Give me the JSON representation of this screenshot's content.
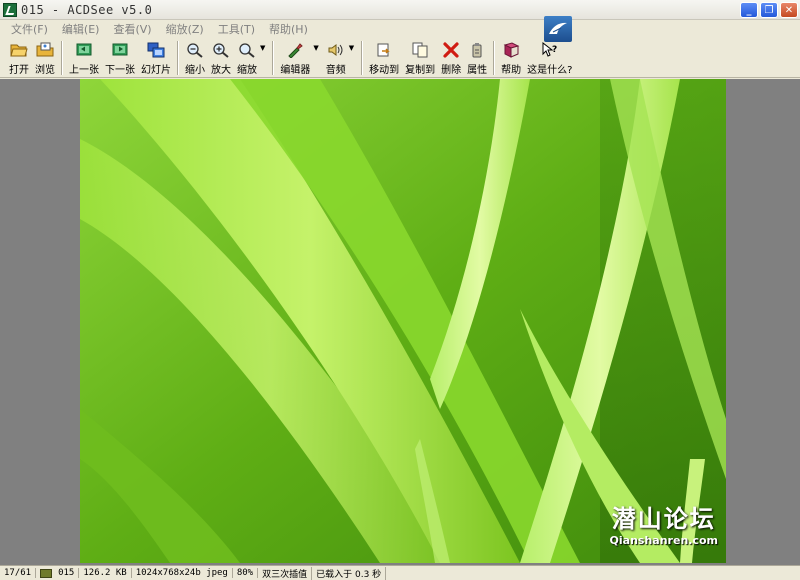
{
  "window": {
    "title": "015 - ACDSee v5.0",
    "controls": [
      "_",
      "❐",
      "✕"
    ]
  },
  "menu": {
    "items": [
      "文件(F)",
      "编辑(E)",
      "查看(V)",
      "缩放(Z)",
      "工具(T)",
      "帮助(H)"
    ]
  },
  "toolbar": {
    "open": "打开",
    "browse": "浏览",
    "prev": "上一张",
    "next": "下一张",
    "slideshow": "幻灯片",
    "zoom_out": "缩小",
    "zoom_in": "放大",
    "zoom": "缩放",
    "editor": "编辑器",
    "audio": "音频",
    "move_to": "移动到",
    "copy_to": "复制到",
    "delete": "删除",
    "properties": "属性",
    "help": "帮助",
    "whats_this": "这是什么?"
  },
  "status": {
    "index": "17/61",
    "name": "015",
    "size": "126.2 KB",
    "dims": "1024x768x24b jpeg",
    "zoom": "80%",
    "interp": "双三次插值",
    "load": "已载入于 0.3 秒"
  },
  "watermark": {
    "big": "潜山论坛",
    "small": "Qianshanren.com"
  },
  "colors": {
    "titlebar": "#eeede6",
    "chrome": "#ece9d8",
    "viewer_bg": "#808080",
    "grass": "#7cc520"
  }
}
